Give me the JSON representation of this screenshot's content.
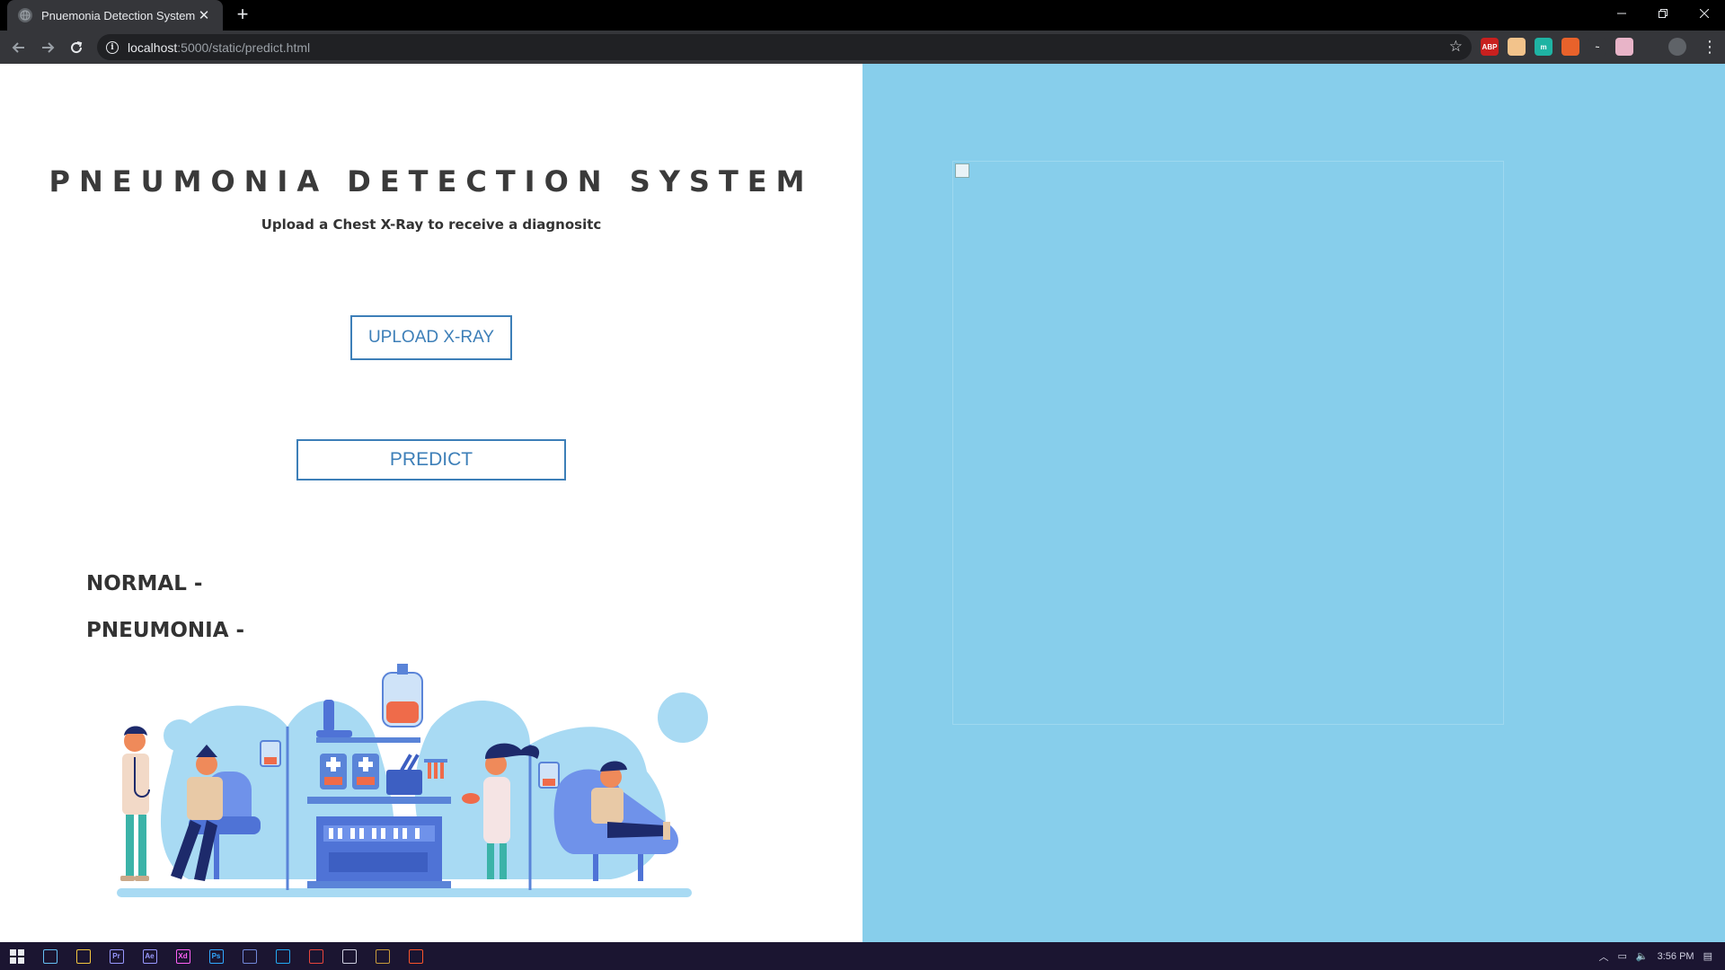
{
  "browser": {
    "tab_title": "Pnuemonia Detection System",
    "tab_close": "✕",
    "new_tab": "+",
    "url_host": "localhost",
    "url_path": ":5000/static/predict.html",
    "extensions": [
      {
        "name": "abp-icon",
        "label": "ABP",
        "color": "#c8201f"
      },
      {
        "name": "extension-egg-icon",
        "label": "",
        "color": "#f2c38b"
      },
      {
        "name": "extension-m-icon",
        "label": "m",
        "color": "#1fb3a3"
      },
      {
        "name": "extension-flag-icon",
        "label": "",
        "color": "#e8622b"
      },
      {
        "name": "extension-wave-icon",
        "label": "~",
        "color": "#35363a"
      },
      {
        "name": "extension-gift-icon",
        "label": "",
        "color": "#e8b4c8"
      }
    ]
  },
  "page": {
    "title": "PNEUMONIA DETECTION SYSTEM",
    "subtitle": "Upload a Chest X-Ray to receive a diagnositc",
    "upload_button": "UPLOAD X-RAY",
    "predict_button": "PREDICT",
    "result_normal": "NORMAL -",
    "result_pneumonia": "PNEUMONIA -"
  },
  "taskbar": {
    "time": "3:56 PM",
    "apps": [
      {
        "name": "steam-icon",
        "color": "#66c0f4",
        "label": ""
      },
      {
        "name": "file-explorer-icon",
        "color": "#f3c640",
        "label": ""
      },
      {
        "name": "premiere-icon",
        "color": "#9999ff",
        "label": "Pr"
      },
      {
        "name": "after-effects-icon",
        "color": "#9999ff",
        "label": "Ae"
      },
      {
        "name": "xd-icon",
        "color": "#ff61f6",
        "label": "Xd"
      },
      {
        "name": "photoshop-icon",
        "color": "#31a8ff",
        "label": "Ps"
      },
      {
        "name": "discord-icon",
        "color": "#7289da",
        "label": ""
      },
      {
        "name": "vscode-icon",
        "color": "#23a9f2",
        "label": ""
      },
      {
        "name": "chrome-icon",
        "color": "#e8453c",
        "label": ""
      },
      {
        "name": "epic-icon",
        "color": "#cfcfe0",
        "label": ""
      },
      {
        "name": "league-icon",
        "color": "#c89b3c",
        "label": ""
      },
      {
        "name": "brave-icon",
        "color": "#fb542b",
        "label": ""
      }
    ]
  },
  "colors": {
    "accent": "#3d7fb8",
    "right_panel": "#87ceeb",
    "title_text": "#3a3a3a"
  }
}
